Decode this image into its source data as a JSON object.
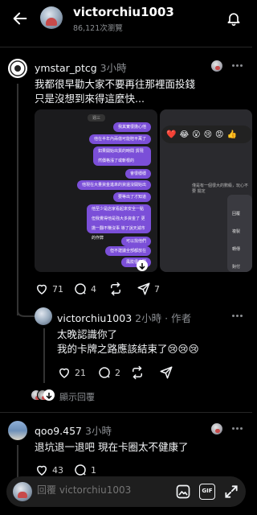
{
  "header": {
    "title": "victorchiu1003",
    "views": "86,121次瀏覽"
  },
  "post1": {
    "username": "ymstar_ptcg",
    "time": "3小時",
    "lines": [
      "我都很早勸大家不要再往那裡面投錢",
      "只是沒想到來得這麼快..."
    ],
    "likes": "71",
    "comments": "4",
    "reposts": "",
    "shares": "7",
    "image1": {
      "label": "週三",
      "bubbles": [
        "我其實很擔心他",
        "他在半年內兩億可能賠平萬了",
        "如果開始出貨的時間 貨現然價格漲了或斬根的",
        "會很穩穩",
        "他現在大量資金進來的資還沒開始出",
        "要等出了才知道",
        "他至少是店家看起來安全一點 但我覺得他是強大多資金了 更擔一翻不賺沒事 導了說天減市的作弊",
        "可以找他們",
        "但不建議全部都放在",
        "風險很高耶"
      ]
    },
    "image2": {
      "emojis": [
        "❤️",
        "😂",
        "😮",
        "😢",
        "😡",
        "👍"
      ],
      "text": "僅是有一個很大的數級，玩心不要 擺定",
      "menu": [
        "回覆",
        "複製",
        "轉傳",
        "對付"
      ]
    }
  },
  "reply": {
    "username": "victorchiu1003",
    "time": "2小時",
    "author_tag": "作者",
    "lines": [
      "太晚認識你了",
      "我的卡牌之路應該結束了😢😢😢"
    ],
    "likes": "21",
    "comments": "2",
    "reposts": "",
    "shares": ""
  },
  "show_replies": "顯示回覆",
  "post2": {
    "username": "qoo9.457",
    "time": "3小時",
    "lines": [
      "退坑退一退吧 現在卡圈太不健康了"
    ],
    "likes": "43",
    "comments": "1"
  },
  "reply_bar": {
    "placeholder": "回覆 victorchiu1003",
    "gif_label": "GIF"
  },
  "colors": {
    "background": "#000000",
    "bubble": "#7b4fd8",
    "muted": "#8a8d91"
  }
}
